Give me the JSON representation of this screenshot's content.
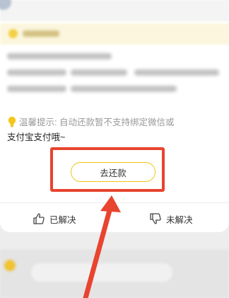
{
  "tip": {
    "label": "温馨提示:",
    "text_line1": "自动还款暂不支持绑定微信或",
    "text_line2": "支付宝支付哦~"
  },
  "actions": {
    "pay_label": "去还款"
  },
  "feedback": {
    "solved_label": "已解决",
    "unsolved_label": "未解决"
  },
  "colors": {
    "accent_yellow": "#f0c419",
    "highlight_red": "#e8442f"
  },
  "icons": {
    "tip": "lightbulb-icon",
    "solved": "thumbs-up-icon",
    "unsolved": "thumbs-down-icon"
  }
}
